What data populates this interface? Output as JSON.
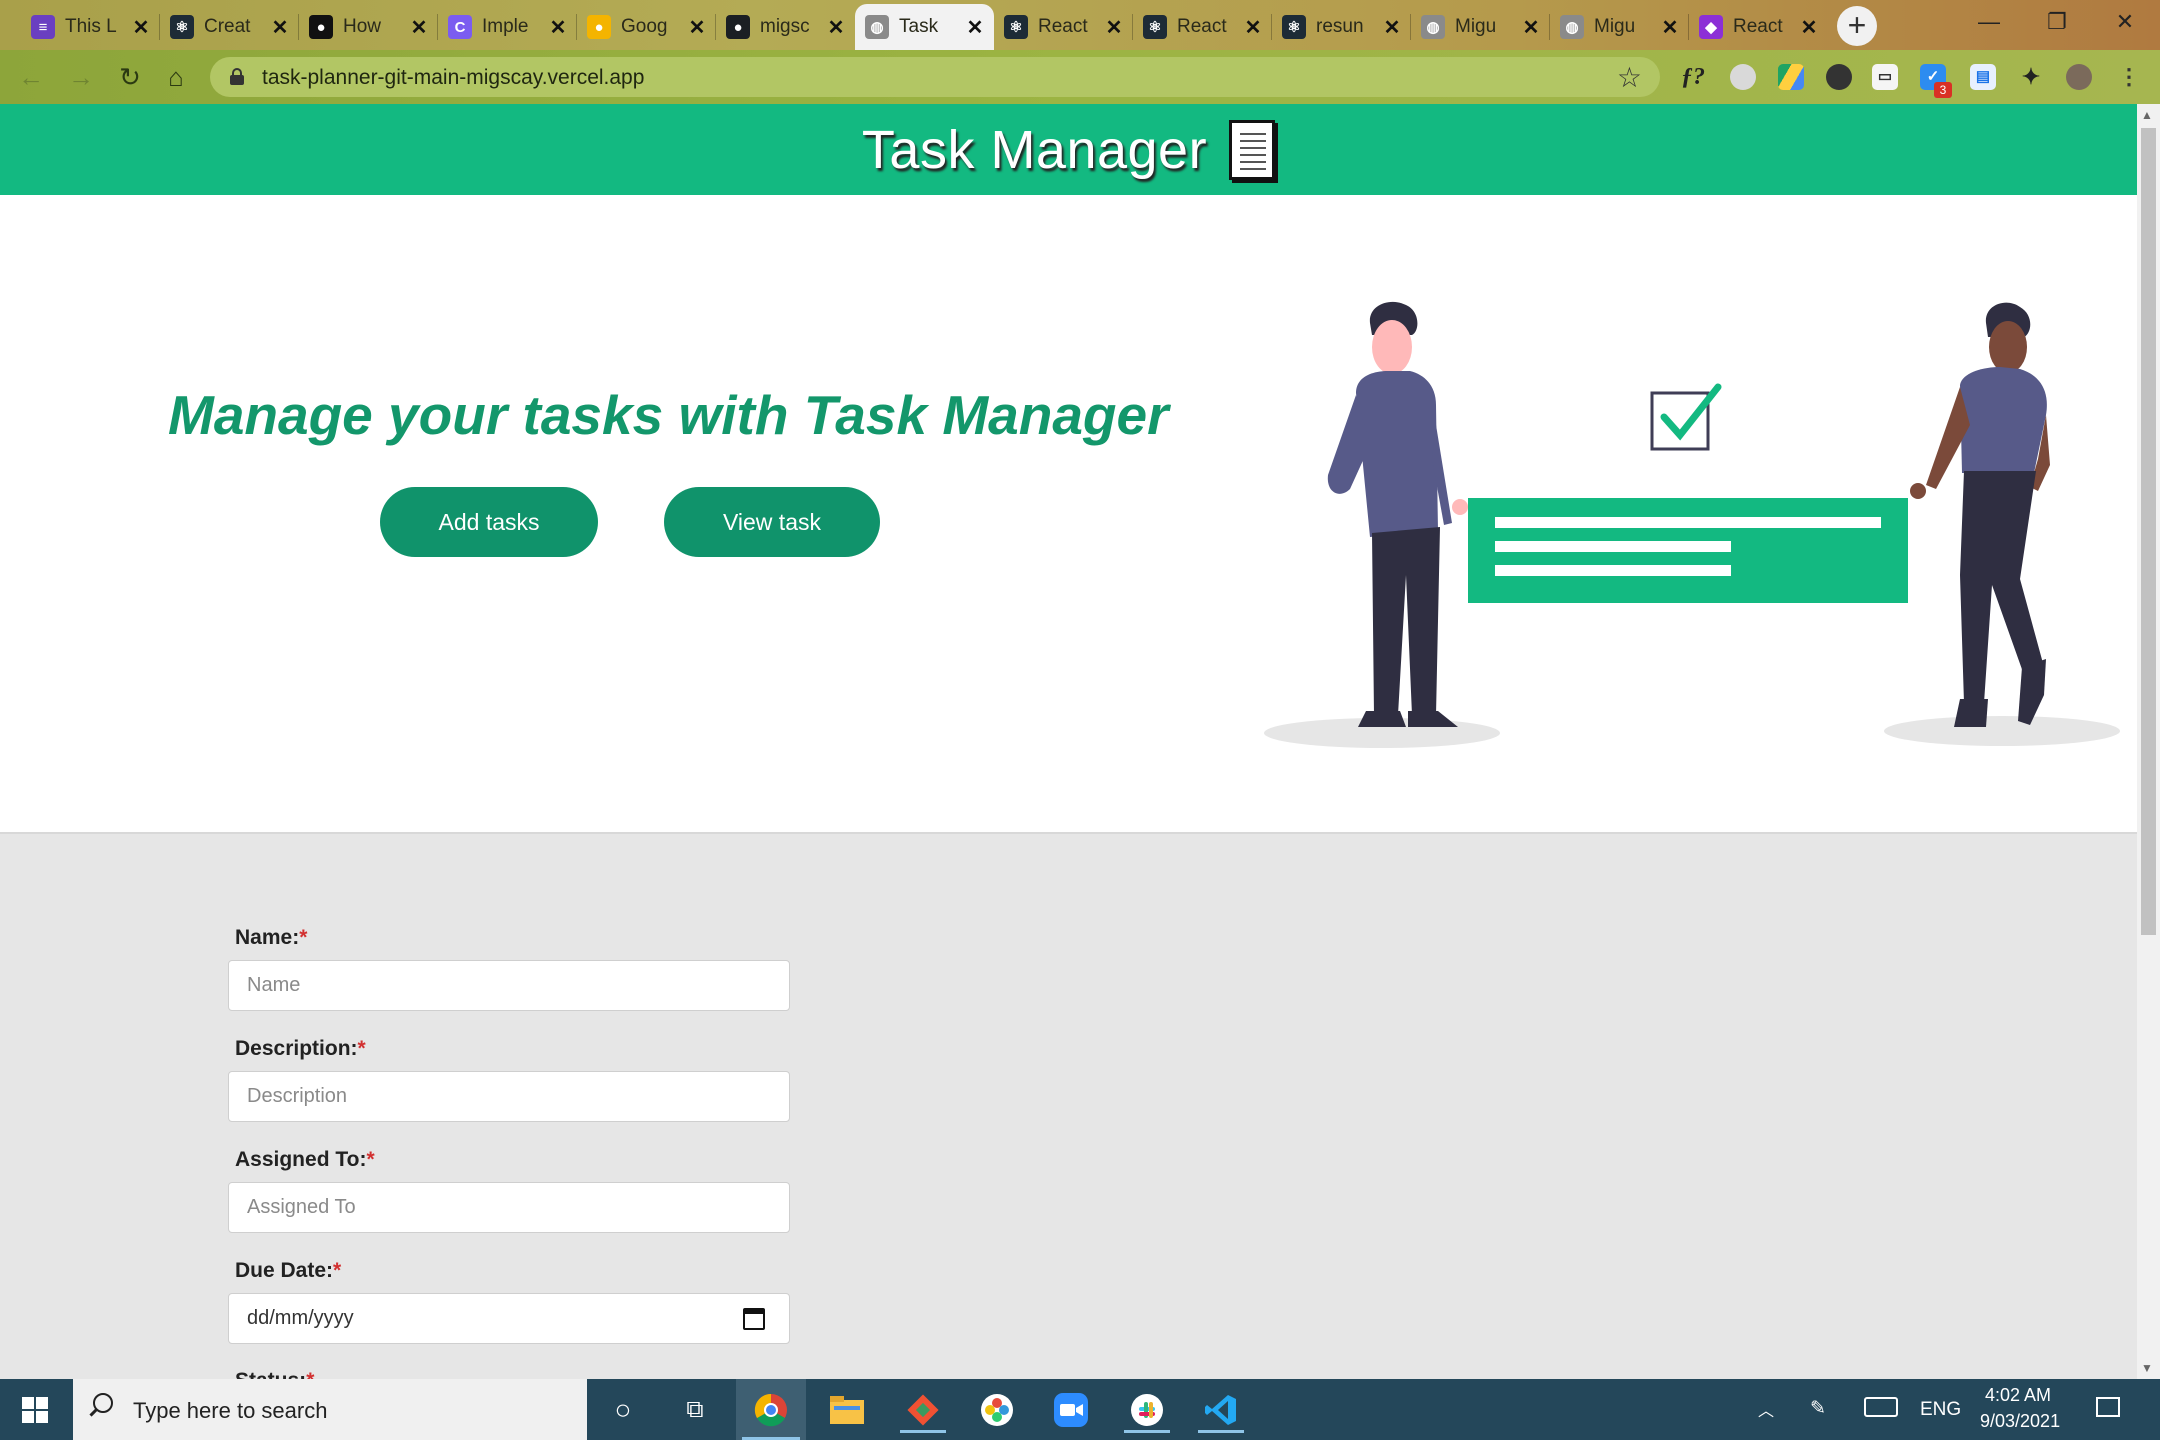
{
  "browser": {
    "tabs": [
      {
        "label": "This L",
        "icon": "list-icon",
        "color": "#6a3fc1",
        "glyph": "≡"
      },
      {
        "label": "Creat",
        "icon": "react-icon",
        "color": "#1d2b36",
        "glyph": "⚛"
      },
      {
        "label": "How",
        "icon": "medium-icon",
        "color": "#111111",
        "glyph": "●"
      },
      {
        "label": "Imple",
        "icon": "clickup-icon",
        "color": "#7b5cf0",
        "glyph": "C"
      },
      {
        "label": "Goog",
        "icon": "lightbulb-icon",
        "color": "#f4b400",
        "glyph": "●"
      },
      {
        "label": "migsc",
        "icon": "github-icon",
        "color": "#1b1f23",
        "glyph": "●"
      },
      {
        "label": "Task",
        "icon": "globe-icon",
        "color": "#8a8a8a",
        "glyph": "◍",
        "active": true
      },
      {
        "label": "React",
        "icon": "react-icon",
        "color": "#1d2b36",
        "glyph": "⚛"
      },
      {
        "label": "React",
        "icon": "react-icon",
        "color": "#1d2b36",
        "glyph": "⚛"
      },
      {
        "label": "resun",
        "icon": "react-icon",
        "color": "#1d2b36",
        "glyph": "⚛"
      },
      {
        "label": "Migu",
        "icon": "globe-icon",
        "color": "#8a8a8a",
        "glyph": "◍"
      },
      {
        "label": "Migu",
        "icon": "globe-icon",
        "color": "#8a8a8a",
        "glyph": "◍"
      },
      {
        "label": "React",
        "icon": "stack-icon",
        "color": "#8c2fd6",
        "glyph": "◆"
      }
    ],
    "new_tab": "+",
    "url": "task-planner-git-main-migscay.vercel.app",
    "extension_badge": "3"
  },
  "app": {
    "title": "Task Manager",
    "hero_heading": "Manage your tasks with Task Manager",
    "add_tasks_label": "Add tasks",
    "view_task_label": "View task"
  },
  "form": {
    "required_mark": "*",
    "fields": [
      {
        "label": "Name:",
        "placeholder": "Name"
      },
      {
        "label": "Description:",
        "placeholder": "Description"
      },
      {
        "label": "Assigned To:",
        "placeholder": "Assigned To"
      },
      {
        "label": "Due Date:",
        "value": "dd/mm/yyyy"
      },
      {
        "label": "Status:"
      }
    ]
  },
  "taskbar": {
    "search_placeholder": "Type here to search",
    "language": "ENG",
    "time": "4:02 AM",
    "date": "9/03/2021"
  },
  "colors": {
    "brand_green": "#13b981",
    "button_green": "#10936b",
    "heading_green": "#13976b"
  }
}
